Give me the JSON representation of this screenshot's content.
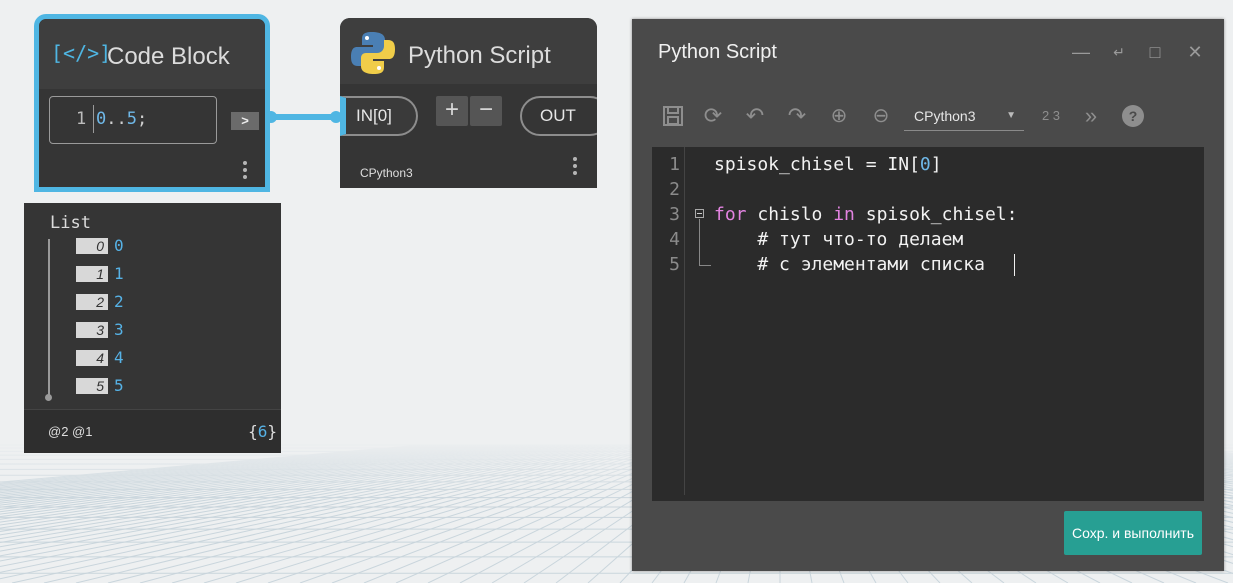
{
  "code_block": {
    "icon": "code-bracket-icon",
    "title": "Code Block",
    "line_number": "1",
    "code_range_start": "0",
    "code_range_dots": "..",
    "code_range_end": "5",
    "code_semicolon": ";",
    "out_port": ">"
  },
  "python_node": {
    "icon": "python-logo-icon",
    "title": "Python Script",
    "in_port": "IN[0]",
    "add_port": "+",
    "remove_port": "−",
    "out_port": "OUT",
    "engine": "CPython3"
  },
  "list_preview": {
    "title": "List",
    "items": [
      {
        "index": "0",
        "value": "0"
      },
      {
        "index": "1",
        "value": "1"
      },
      {
        "index": "2",
        "value": "2"
      },
      {
        "index": "3",
        "value": "3"
      },
      {
        "index": "4",
        "value": "4"
      },
      {
        "index": "5",
        "value": "5"
      }
    ],
    "levels": "@2 @1",
    "count_open": "{",
    "count": "6",
    "count_close": "}"
  },
  "editor": {
    "title": "Python Script",
    "window_controls": [
      "minimize-icon",
      "restore-icon",
      "maximize-icon",
      "close-icon"
    ],
    "toolbar_icons": [
      "save-icon",
      "reload-icon",
      "undo-icon",
      "redo-icon",
      "zoom-in-icon",
      "zoom-out-icon",
      "convert-icon",
      "more-icon",
      "help-icon"
    ],
    "engine": "CPython3",
    "convert_label": "2 3",
    "lines": [
      {
        "no": "1",
        "a": "spisok_chisel = IN[",
        "n": "0",
        "b": "]"
      },
      {
        "no": "2"
      },
      {
        "no": "3",
        "kw1": "for",
        "t1": " chislo ",
        "kw2": "in",
        "t2": " spisok_chisel:"
      },
      {
        "no": "4",
        "comment": "    # тут что-то делаем"
      },
      {
        "no": "5",
        "comment": "    # с элементами списка"
      }
    ],
    "run_button": "Сохр. и выполнить"
  }
}
